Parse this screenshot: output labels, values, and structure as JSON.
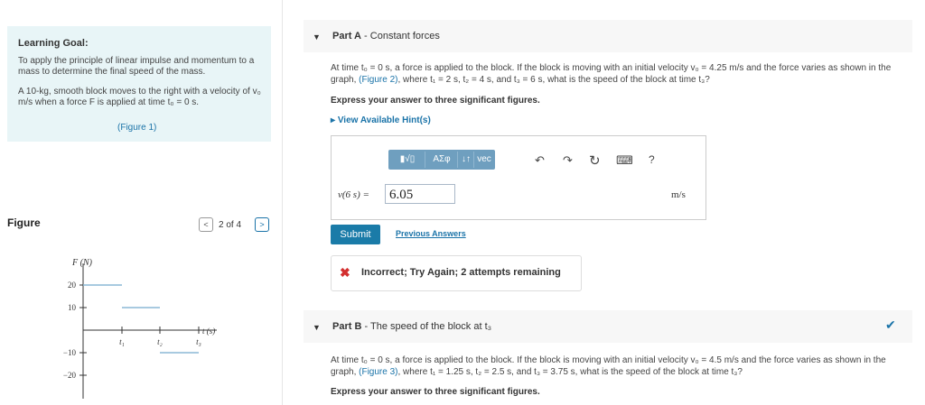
{
  "learning_goal": {
    "title": "Learning Goal:",
    "text": "To apply the principle of linear impulse and momentum to a mass to determine the final speed of the mass.",
    "setup": "A 10-kg, smooth block moves to the right with a velocity of v₀ m/s when a force F is applied at time t₀ = 0 s.",
    "figure_link": "(Figure 1)"
  },
  "figure": {
    "title": "Figure",
    "pager": "2 of 4",
    "prev": "<",
    "next": ">"
  },
  "chart_data": {
    "type": "line",
    "title": "",
    "xlabel": "t (s)",
    "ylabel": "F (N)",
    "x_ticks": [
      "t₁",
      "t₂",
      "t₃"
    ],
    "y_ticks": [
      "20",
      "10",
      "−10",
      "−20"
    ],
    "ylim": [
      -25,
      25
    ],
    "segments": [
      {
        "from": "0",
        "to": "t₁",
        "value": 20
      },
      {
        "from": "t₁",
        "to": "t₂",
        "value": 10
      },
      {
        "from": "t₂",
        "to": "t₃",
        "value": -10
      }
    ]
  },
  "part_a": {
    "toggle": "▼",
    "label": "Part A",
    "sep": " - ",
    "name": "Constant forces",
    "question_pre": "At time t₀ = 0 s, a force is applied to the block. If the block is moving with an initial velocity v₀ = 4.25 m/s and the force varies as shown in the graph, ",
    "question_link": "(Figure 2)",
    "question_post": ", where t₁ = 2 s, t₂ = 4 s, and t₃ = 6 s, what is the speed of the block at time t₃?",
    "instruction": "Express your answer to three significant figures.",
    "hint": "View Available Hint(s)",
    "toolbar": [
      "▮√▯",
      "ΑΣφ",
      "↓↑",
      "vec"
    ],
    "tools": [
      "undo-arrow",
      "redo-arrow",
      "reset",
      "keyboard",
      "help"
    ],
    "tool_glyphs": {
      "undo": "↶",
      "redo": "↷",
      "reset": "↻",
      "keyboard": "⌨",
      "help": "?"
    },
    "answer_label": "v(6 s) =",
    "answer_value": "6.05",
    "unit": "m/s",
    "submit": "Submit",
    "previous_answers": "Previous Answers",
    "feedback": "Incorrect; Try Again; 2 attempts remaining"
  },
  "part_b": {
    "toggle": "▼",
    "label": "Part B",
    "sep": " - ",
    "name": "The speed of the block at t₃",
    "question_pre": "At time t₀ = 0 s, a force is applied to the block. If the block is moving with an initial velocity v₀ = 4.5 m/s and the force varies as shown in the graph, ",
    "question_link": "(Figure 3)",
    "question_post": ", where t₁ = 1.25 s, t₂ = 2.5 s, and t₃ = 3.75 s, what is the speed of the block at time t₃?",
    "instruction": "Express your answer to three significant figures.",
    "check": "✔"
  }
}
